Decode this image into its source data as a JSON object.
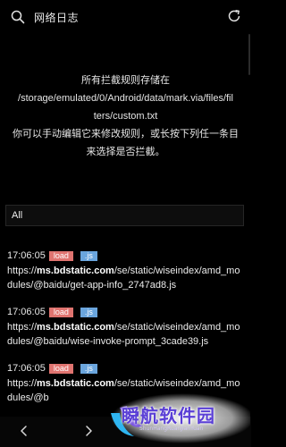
{
  "header": {
    "title": "网络日志"
  },
  "info": {
    "lines": [
      "所有拦截规则存储在",
      "/storage/emulated/0/Android/data/mark.via/files/fil",
      "ters/custom.txt",
      "你可以手动编辑它来修改规则，或长按下列任一条目",
      "来选择是否拦截。"
    ]
  },
  "filter": {
    "value": "All"
  },
  "logs": [
    {
      "time": "17:06:05",
      "type": "load",
      "ext": ".js",
      "url_prefix": "https://",
      "url_host": "ms.bdstatic.com",
      "url_path": "/se/static/wiseindex/amd_modules/@baidu/get-app-info_2747ad8.js"
    },
    {
      "time": "17:06:05",
      "type": "load",
      "ext": ".js",
      "url_prefix": "https://",
      "url_host": "ms.bdstatic.com",
      "url_path": "/se/static/wiseindex/amd_modules/@baidu/wise-invoke-prompt_3cade39.js"
    },
    {
      "time": "17:06:05",
      "type": "load",
      "ext": ".js",
      "url_prefix": "https://",
      "url_host": "ms.bdstatic.com",
      "url_path": "/se/static/wiseindex/amd_modules/@b"
    }
  ],
  "watermark": {
    "text": "瞬航软件园",
    "sub": "ShunHangRuanJianYuan"
  },
  "colors": {
    "background": "#000000",
    "badge_load": "#e07470",
    "badge_js": "#6aa5dd",
    "watermark": "#5a3fd6"
  }
}
